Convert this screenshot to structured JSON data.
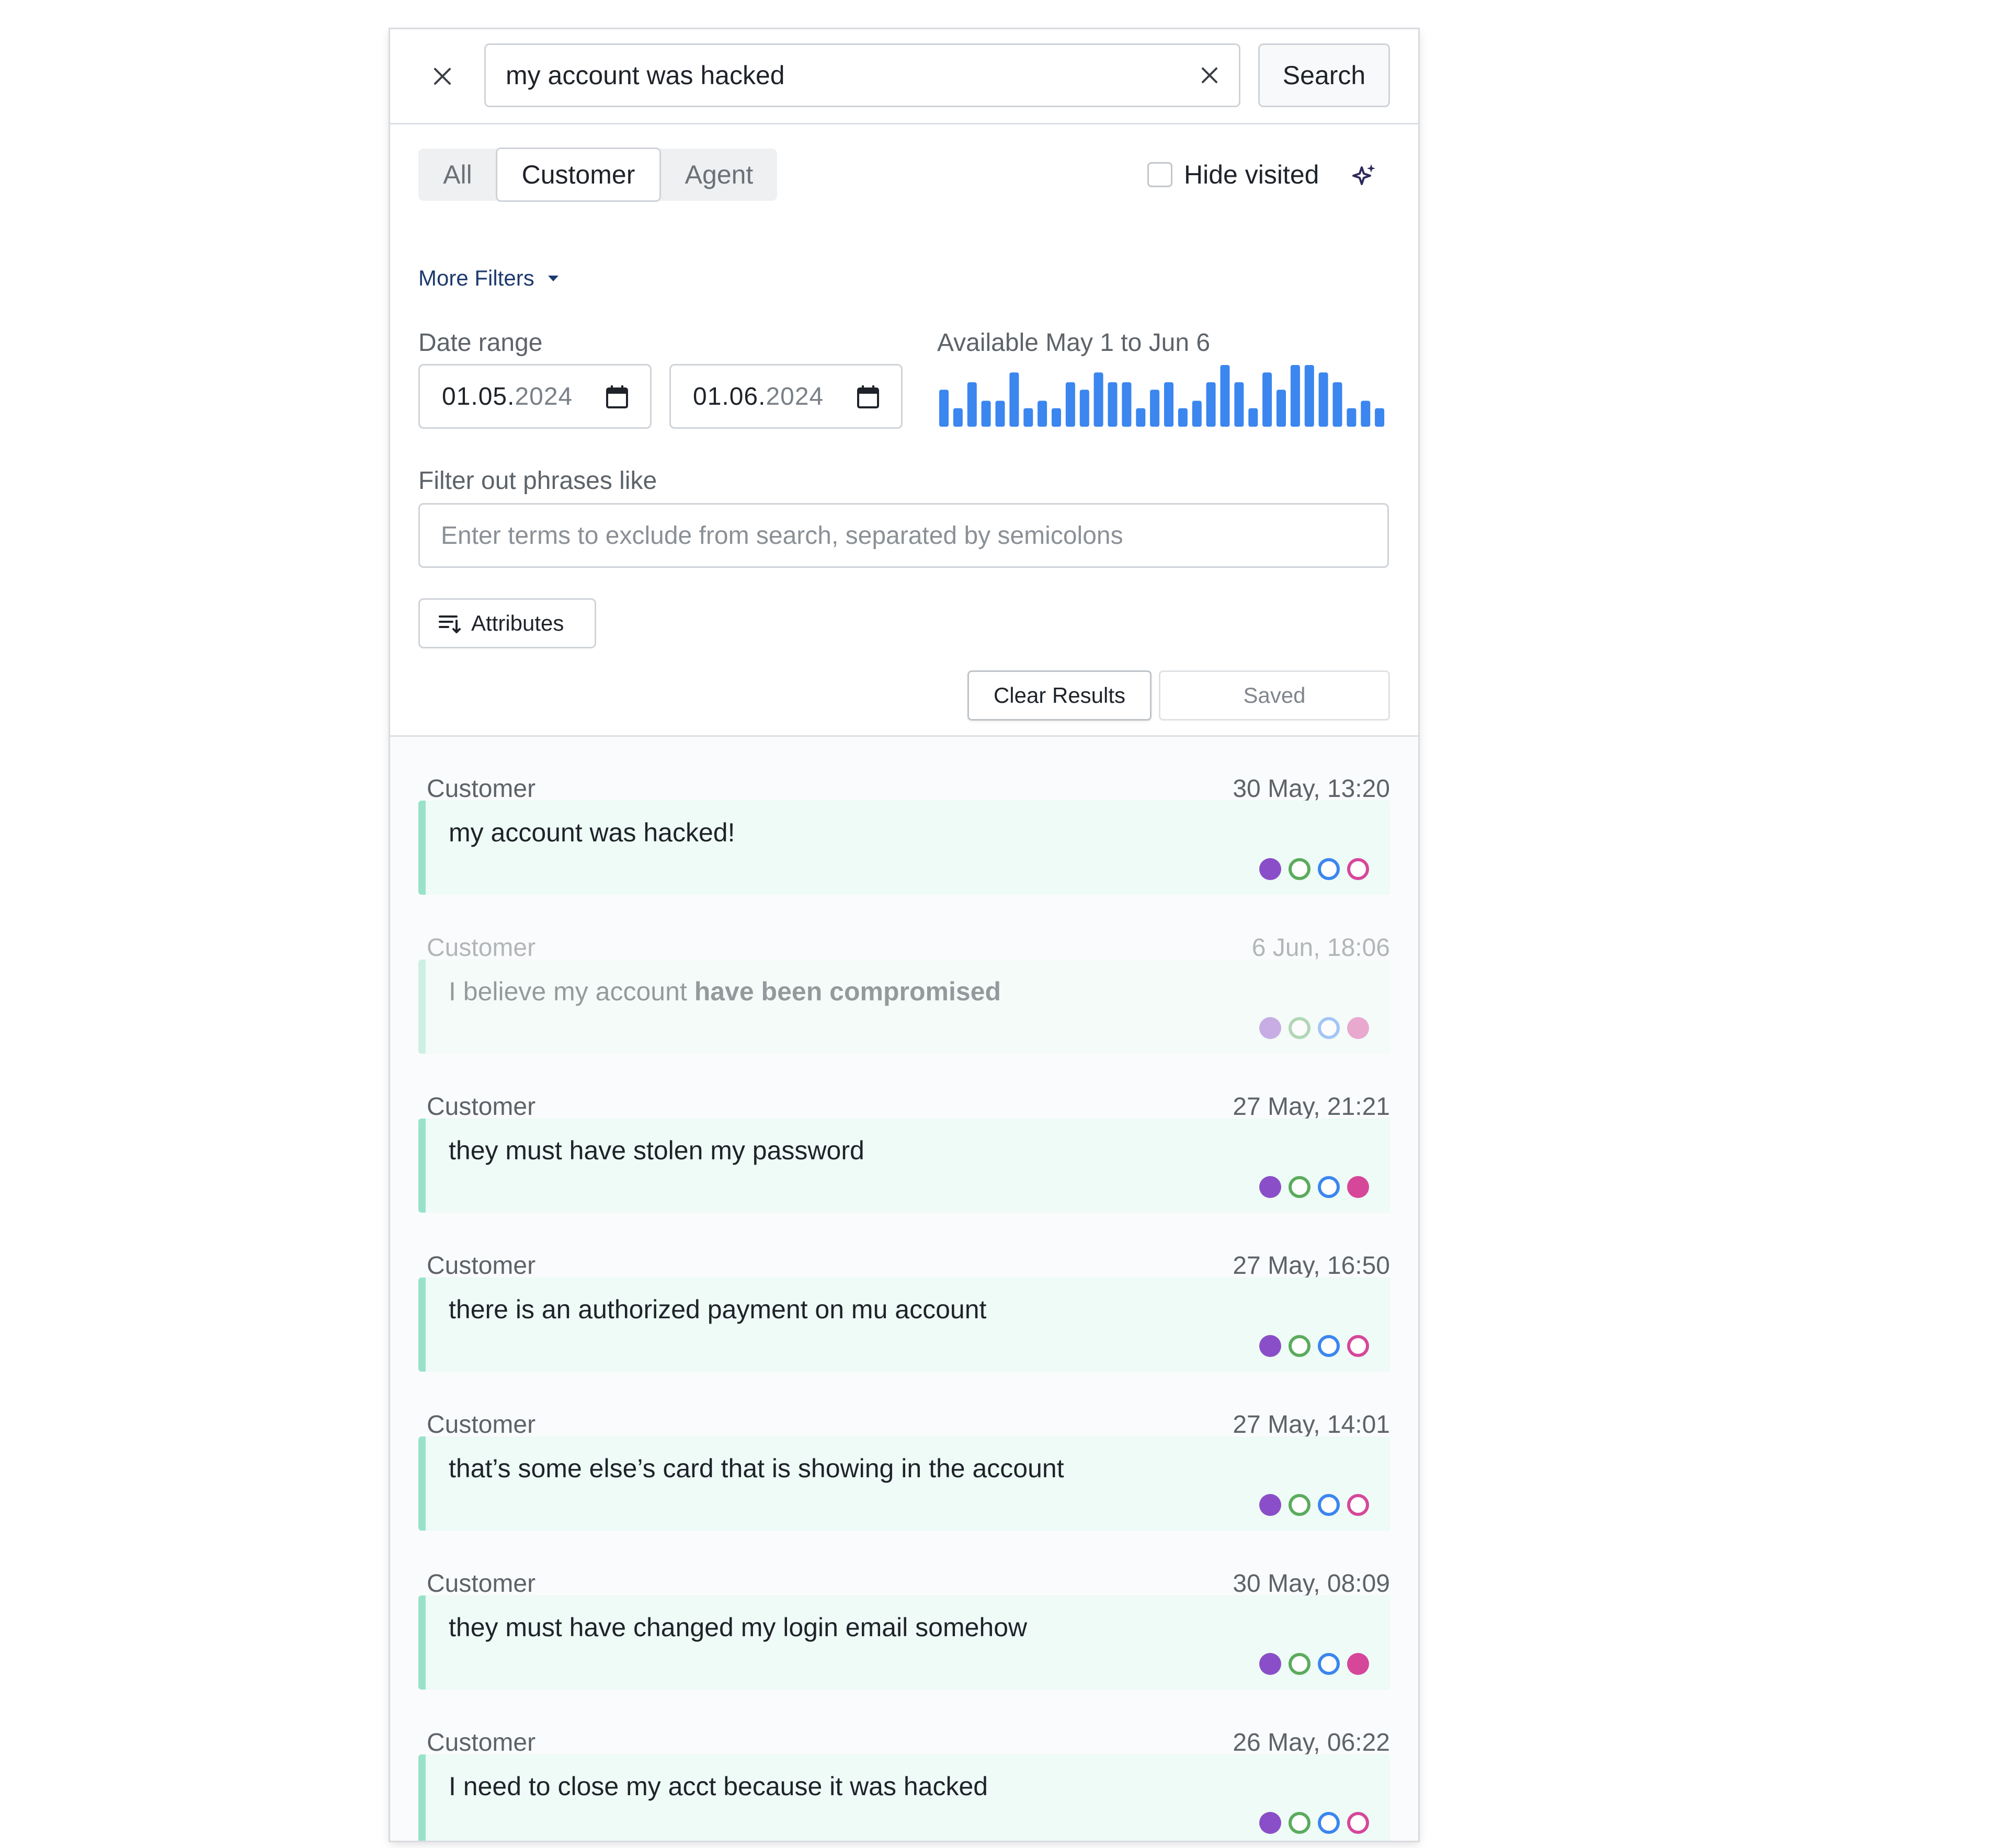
{
  "search": {
    "query": "my account was hacked",
    "button_label": "Search"
  },
  "role_filter": {
    "options": [
      "All",
      "Customer",
      "Agent"
    ],
    "selected": "Customer"
  },
  "hide_visited": {
    "label": "Hide visited",
    "checked": false
  },
  "more_filters_label": "More Filters",
  "date_range": {
    "label": "Date range",
    "start": {
      "day_month": "01.05.",
      "year": "2024"
    },
    "end": {
      "day_month": "01.06.",
      "year": "2024"
    }
  },
  "availability": {
    "label": "Available May 1 to Jun 6",
    "bar_color": "#3b86ef",
    "relative_counts": [
      0.6,
      0.3,
      0.72,
      0.42,
      0.42,
      0.88,
      0.3,
      0.42,
      0.3,
      0.72,
      0.6,
      0.88,
      0.72,
      0.72,
      0.3,
      0.6,
      0.72,
      0.3,
      0.42,
      0.72,
      1.0,
      0.72,
      0.3,
      0.88,
      0.6,
      1.0,
      1.0,
      0.88,
      0.72,
      0.3,
      0.42,
      0.3
    ]
  },
  "exclude": {
    "label": "Filter out phrases like",
    "placeholder": "Enter terms to exclude from search, separated by semicolons",
    "value": ""
  },
  "attributes_button_label": "Attributes",
  "actions": {
    "clear_label": "Clear Results",
    "saved_label": "Saved"
  },
  "colors": {
    "accent_card_bg": "#eefbf6",
    "accent_card_bar": "#99e2c9",
    "purple": "#8a4fc8",
    "green": "#5bab5d",
    "blue": "#3b86ef",
    "pink": "#d6479a"
  },
  "results": [
    {
      "speaker": "Customer",
      "timestamp": "30 May, 13:20",
      "text_before": "my account was hacked!",
      "text_bold": "",
      "visited": false,
      "dots": [
        "filled",
        "outline",
        "outline",
        "outline"
      ]
    },
    {
      "speaker": "Customer",
      "timestamp": "6 Jun, 18:06",
      "text_before": "I believe my account ",
      "text_bold": "have been compromised",
      "visited": true,
      "dots": [
        "filled",
        "outline",
        "outline",
        "filled"
      ]
    },
    {
      "speaker": "Customer",
      "timestamp": "27 May, 21:21",
      "text_before": "they must have stolen my password",
      "text_bold": "",
      "visited": false,
      "dots": [
        "filled",
        "outline",
        "outline",
        "filled"
      ]
    },
    {
      "speaker": "Customer",
      "timestamp": "27 May, 16:50",
      "text_before": "there is an authorized payment on mu account",
      "text_bold": "",
      "visited": false,
      "dots": [
        "filled",
        "outline",
        "outline",
        "outline"
      ]
    },
    {
      "speaker": "Customer",
      "timestamp": "27 May, 14:01",
      "text_before": "that’s some else’s card that is showing in the account",
      "text_bold": "",
      "visited": false,
      "dots": [
        "filled",
        "outline",
        "outline",
        "outline"
      ]
    },
    {
      "speaker": "Customer",
      "timestamp": "30 May, 08:09",
      "text_before": "they must have changed my login email somehow",
      "text_bold": "",
      "visited": false,
      "dots": [
        "filled",
        "outline",
        "outline",
        "filled"
      ]
    },
    {
      "speaker": "Customer",
      "timestamp": "26 May, 06:22",
      "text_before": "I need to close my acct because it was hacked",
      "text_bold": "",
      "visited": false,
      "dots": [
        "filled",
        "outline",
        "outline",
        "outline"
      ]
    }
  ]
}
